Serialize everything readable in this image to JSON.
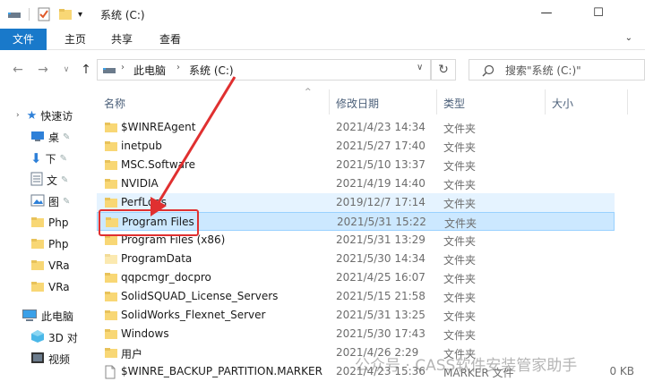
{
  "window": {
    "title": "系统 (C:)",
    "minimize": "—",
    "maximize": "☐"
  },
  "ribbon": {
    "tabs": [
      {
        "label": "文件",
        "active": true
      },
      {
        "label": "主页",
        "active": false
      },
      {
        "label": "共享",
        "active": false
      },
      {
        "label": "查看",
        "active": false
      }
    ]
  },
  "address": {
    "segments": [
      "此电脑",
      "系统 (C:)"
    ],
    "search_placeholder": "搜索\"系统 (C:)\""
  },
  "navpane": {
    "items": [
      {
        "label": "快速访",
        "icon": "star-icon"
      },
      {
        "label": "桌",
        "icon": "desktop-icon"
      },
      {
        "label": "下",
        "icon": "download-icon"
      },
      {
        "label": "文",
        "icon": "document-icon"
      },
      {
        "label": "图",
        "icon": "picture-icon"
      },
      {
        "label": "Php",
        "icon": "folder-icon"
      },
      {
        "label": "Php",
        "icon": "folder-icon"
      },
      {
        "label": "VRa",
        "icon": "folder-icon"
      },
      {
        "label": "VRa",
        "icon": "folder-icon"
      },
      {
        "label": "此电脑",
        "icon": "computer-icon"
      },
      {
        "label": "3D 对",
        "icon": "cube-icon"
      },
      {
        "label": "视频",
        "icon": "video-icon"
      }
    ]
  },
  "columns": {
    "name": "名称",
    "date": "修改日期",
    "type": "类型",
    "size": "大小"
  },
  "files": [
    {
      "name": "$WINREAgent",
      "date": "2021/4/23 14:34",
      "type": "文件夹",
      "size": "",
      "kind": "folder"
    },
    {
      "name": "inetpub",
      "date": "2021/5/27 17:40",
      "type": "文件夹",
      "size": "",
      "kind": "folder"
    },
    {
      "name": "MSC.Software",
      "date": "2021/5/10 13:37",
      "type": "文件夹",
      "size": "",
      "kind": "folder"
    },
    {
      "name": "NVIDIA",
      "date": "2021/4/19 14:40",
      "type": "文件夹",
      "size": "",
      "kind": "folder"
    },
    {
      "name": "PerfLogs",
      "date": "2019/12/7 17:14",
      "type": "文件夹",
      "size": "",
      "kind": "folder"
    },
    {
      "name": "Program Files",
      "date": "2021/5/31 15:22",
      "type": "文件夹",
      "size": "",
      "kind": "folder"
    },
    {
      "name": "Program Files (x86)",
      "date": "2021/5/31 13:29",
      "type": "文件夹",
      "size": "",
      "kind": "folder"
    },
    {
      "name": "ProgramData",
      "date": "2021/5/30 14:34",
      "type": "文件夹",
      "size": "",
      "kind": "folder-light"
    },
    {
      "name": "qqpcmgr_docpro",
      "date": "2021/4/25 16:07",
      "type": "文件夹",
      "size": "",
      "kind": "folder"
    },
    {
      "name": "SolidSQUAD_License_Servers",
      "date": "2021/5/15 21:58",
      "type": "文件夹",
      "size": "",
      "kind": "folder"
    },
    {
      "name": "SolidWorks_Flexnet_Server",
      "date": "2021/5/31 13:25",
      "type": "文件夹",
      "size": "",
      "kind": "folder"
    },
    {
      "name": "Windows",
      "date": "2021/5/30 17:43",
      "type": "文件夹",
      "size": "",
      "kind": "folder"
    },
    {
      "name": "用户",
      "date": "2021/4/26 2:29",
      "type": "文件夹",
      "size": "",
      "kind": "folder"
    },
    {
      "name": "$WINRE_BACKUP_PARTITION.MARKER",
      "date": "2021/4/23 15:36",
      "type": "MARKER 文件",
      "size": "0 KB",
      "kind": "file"
    }
  ],
  "watermark": {
    "text": "公众号 · CASS软件安装管家助手"
  },
  "colors": {
    "accent": "#1979ca",
    "selection": "#cce8ff",
    "folder": "#f8d775",
    "annotation": "#e03030"
  }
}
